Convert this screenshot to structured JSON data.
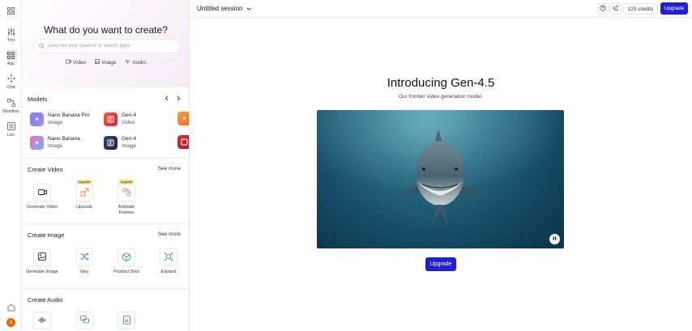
{
  "rail": {
    "items": [
      {
        "icon": "sidebar-toggle-icon",
        "label": ""
      },
      {
        "icon": "sliders-icon",
        "label": "Tool"
      },
      {
        "icon": "grid-icon",
        "label": "App"
      },
      {
        "icon": "sparkle-icon",
        "label": "Chat"
      },
      {
        "icon": "workflow-icon",
        "label": "Workflow"
      },
      {
        "icon": "live-icon",
        "label": "Live"
      }
    ],
    "home_icon": "home-icon",
    "avatar_initial": "X",
    "avatar_color": "#e8630a"
  },
  "hero": {
    "title": "What do you want to create?",
    "search_placeholder": "Describe your creation or search apps",
    "chips": [
      "Video",
      "Image",
      "Audio"
    ]
  },
  "models": {
    "title": "Models",
    "items": [
      {
        "name": "Nano Banana Pro",
        "type": "Image"
      },
      {
        "name": "Gen-4",
        "type": "Video"
      },
      {
        "name": "Nano Banana",
        "type": "Image"
      },
      {
        "name": "Gen-4",
        "type": "Image"
      }
    ]
  },
  "create_video": {
    "title": "Create Video",
    "see_more": "See more",
    "tools": [
      {
        "label": "Generate Video",
        "badge": ""
      },
      {
        "label": "Upscale",
        "badge": "Upgrade"
      },
      {
        "label": "Animate Frames",
        "badge": "Upgrade"
      }
    ]
  },
  "create_image": {
    "title": "Create Image",
    "see_more": "See more",
    "tools": [
      {
        "label": "Generate Image"
      },
      {
        "label": "Vary"
      },
      {
        "label": "Product Shot"
      },
      {
        "label": "Expand"
      }
    ]
  },
  "create_audio": {
    "title": "Create Audio"
  },
  "topbar": {
    "session": "Untitled session",
    "credits": "125 credits",
    "upgrade": "Upgrade"
  },
  "main": {
    "title": "Introducing Gen-4.5",
    "subtitle": "Our frontier video generation model.",
    "upgrade": "Upgrade"
  },
  "colors": {
    "accent": "#1f1fd6",
    "badge": "#f6e27a"
  }
}
